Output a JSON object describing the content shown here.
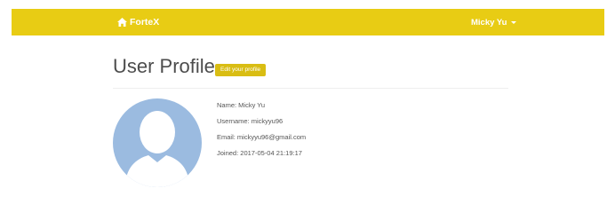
{
  "navbar": {
    "brand_label": "FortеX",
    "brand_icon": "home-icon",
    "user_menu_label": "Micky Yu",
    "user_menu_icon": "caret-down-icon",
    "background_color": "#e8cc14"
  },
  "profile": {
    "title": "User Profile",
    "edit_button_label": "Edit your profile",
    "avatar_icon": "user-avatar-icon",
    "avatar_color": "#9bbbe0",
    "name": "Name: Micky Yu",
    "username": "Username: mickyyu96",
    "email": "Email: mickyyu96@gmail.com",
    "joined": "Joined: 2017-05-04 21:19:17"
  }
}
